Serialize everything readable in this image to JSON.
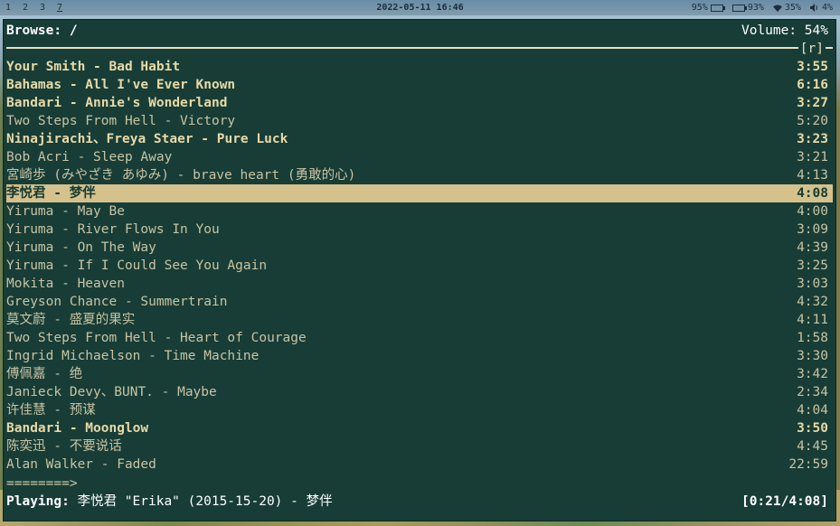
{
  "topbar": {
    "workspaces": [
      "1",
      "2",
      "3",
      "7"
    ],
    "clock": "2022-05-11 16:46",
    "status": {
      "battery1": "95%",
      "battery2": "93%",
      "wifi": "35%",
      "volume": "4%"
    }
  },
  "player": {
    "browse_label": "Browse: /",
    "volume_label": "Volume: 54%",
    "sort_flag": "[r]",
    "tracks": [
      {
        "title": "Your Smith - Bad Habit",
        "duration": "3:55",
        "bold": true
      },
      {
        "title": "Bahamas - All I've Ever Known",
        "duration": "6:16",
        "bold": true
      },
      {
        "title": "Bandari - Annie's Wonderland",
        "duration": "3:27",
        "bold": true
      },
      {
        "title": "Two Steps From Hell - Victory",
        "duration": "5:20",
        "bold": false
      },
      {
        "title": "Ninajirachi、Freya Staer - Pure Luck",
        "duration": "3:23",
        "bold": true
      },
      {
        "title": "Bob Acri - Sleep Away",
        "duration": "3:21",
        "bold": false
      },
      {
        "title": "宮崎歩 (みやざき あゆみ) - brave heart (勇敢的心)",
        "duration": "4:13",
        "bold": false
      },
      {
        "title": "李悦君 - 梦伴",
        "duration": "4:08",
        "bold": true,
        "selected": true
      },
      {
        "title": "Yiruma - May Be",
        "duration": "4:00",
        "bold": false
      },
      {
        "title": "Yiruma - River Flows In You",
        "duration": "3:09",
        "bold": false
      },
      {
        "title": "Yiruma - On The Way",
        "duration": "4:39",
        "bold": false
      },
      {
        "title": "Yiruma - If I Could See You Again",
        "duration": "3:25",
        "bold": false
      },
      {
        "title": "Mokita - Heaven",
        "duration": "3:03",
        "bold": false
      },
      {
        "title": "Greyson Chance - Summertrain",
        "duration": "4:32",
        "bold": false
      },
      {
        "title": "莫文蔚 - 盛夏的果实",
        "duration": "4:11",
        "bold": false
      },
      {
        "title": "Two Steps From Hell - Heart of Courage",
        "duration": "1:58",
        "bold": false
      },
      {
        "title": "Ingrid Michaelson - Time Machine",
        "duration": "3:30",
        "bold": false
      },
      {
        "title": "傅佩嘉 - 绝",
        "duration": "3:42",
        "bold": false
      },
      {
        "title": "Janieck Devy、BUNT. - Maybe",
        "duration": "2:34",
        "bold": false
      },
      {
        "title": "许佳慧 - 预谋",
        "duration": "4:04",
        "bold": false
      },
      {
        "title": "Bandari - Moonglow",
        "duration": "3:50",
        "bold": true
      },
      {
        "title": "陈奕迅 - 不要说话",
        "duration": "4:45",
        "bold": false
      },
      {
        "title": "Alan Walker - Faded",
        "duration": "22:59",
        "bold": false
      }
    ],
    "progress_bar": "========>",
    "playing_label": "Playing:",
    "playing_text": "李悦君 \"Erika\" (2015-15-20) - 梦伴",
    "playing_time": "[0:21/4:08]"
  }
}
